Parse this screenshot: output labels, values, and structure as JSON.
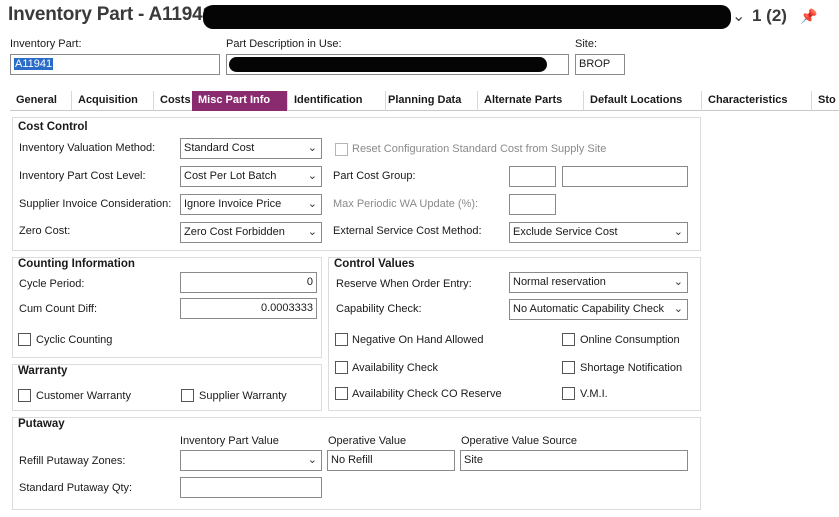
{
  "header": {
    "title": "Inventory Part - A11941",
    "record_count": "1 (2)"
  },
  "fields": {
    "inventory_part_label": "Inventory Part:",
    "inventory_part_value": "A11941",
    "part_description_label": "Part Description in Use:",
    "part_description_value": "",
    "site_label": "Site:",
    "site_value": "BROP"
  },
  "tabs": [
    "General",
    "Acquisition",
    "Costs",
    "Misc Part Info",
    "Identification",
    "Planning Data",
    "Alternate Parts",
    "Default Locations",
    "Characteristics",
    "Sto"
  ],
  "active_tab": "Misc Part Info",
  "cost_control": {
    "title": "Cost Control",
    "valuation_method_label": "Inventory Valuation Method:",
    "valuation_method_value": "Standard Cost",
    "cost_level_label": "Inventory Part Cost Level:",
    "cost_level_value": "Cost Per Lot Batch",
    "supplier_invoice_label": "Supplier Invoice Consideration:",
    "supplier_invoice_value": "Ignore Invoice Price",
    "zero_cost_label": "Zero Cost:",
    "zero_cost_value": "Zero Cost Forbidden",
    "reset_config_label": "Reset Configuration Standard Cost from Supply Site",
    "part_cost_group_label": "Part Cost Group:",
    "part_cost_group_value": "",
    "part_cost_group_desc": "",
    "max_periodic_label": "Max Periodic WA Update (%):",
    "max_periodic_value": "",
    "ext_service_label": "External Service Cost Method:",
    "ext_service_value": "Exclude Service Cost"
  },
  "counting": {
    "title": "Counting Information",
    "cycle_period_label": "Cycle Period:",
    "cycle_period_value": "0",
    "cum_count_label": "Cum Count Diff:",
    "cum_count_value": "0.0003333",
    "cyclic_counting_label": "Cyclic Counting"
  },
  "control_values": {
    "title": "Control Values",
    "reserve_label": "Reserve When Order Entry:",
    "reserve_value": "Normal reservation",
    "capability_label": "Capability Check:",
    "capability_value": "No Automatic Capability Check",
    "negative_on_hand": "Negative On Hand Allowed",
    "online_consumption": "Online Consumption",
    "availability_check": "Availability Check",
    "shortage_notification": "Shortage Notification",
    "availability_check_co": "Availability Check CO Reserve",
    "vmi": "V.M.I."
  },
  "warranty": {
    "title": "Warranty",
    "customer_warranty": "Customer Warranty",
    "supplier_warranty": "Supplier Warranty"
  },
  "putaway": {
    "title": "Putaway",
    "col_inventory_part_value": "Inventory Part Value",
    "col_operative_value": "Operative Value",
    "col_operative_value_source": "Operative Value Source",
    "refill_zones_label": "Refill Putaway Zones:",
    "refill_zones_inv_value": "",
    "refill_zones_operative": "No Refill",
    "refill_zones_source": "Site",
    "std_putaway_qty_label": "Standard Putaway Qty:",
    "std_putaway_qty_value": ""
  }
}
